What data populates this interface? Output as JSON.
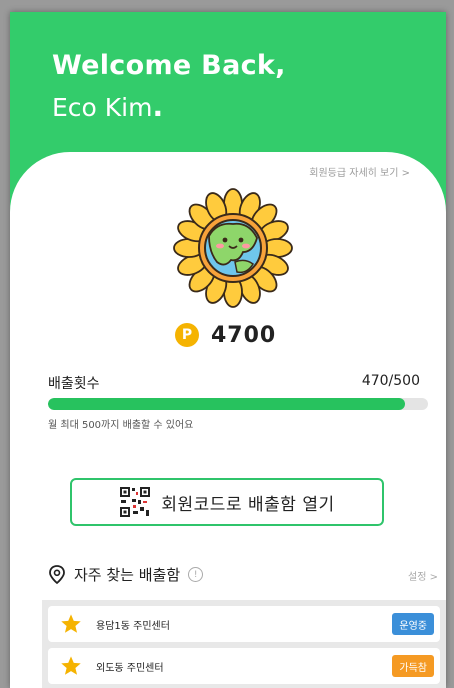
{
  "header": {
    "greeting": "Welcome Back,",
    "user_name": "Eco Kim",
    "user_suffix": "."
  },
  "grade_link": "회원등급 자세히 보기 >",
  "points": {
    "icon_letter": "P",
    "value": "4700"
  },
  "emission": {
    "label": "배출횟수",
    "value_text": "470/500",
    "progress": 0.94,
    "note": "월 최대 500까지 배출할 수 있어요"
  },
  "open_button": {
    "label": "회원코드로 배출함 열기"
  },
  "favorites": {
    "title": "자주 찾는 배출함",
    "info_icon": "!",
    "settings_label": "설정 >",
    "items": [
      {
        "name": "용담1동 주민센터",
        "status": "운영중",
        "status_color": "#3b8fd9"
      },
      {
        "name": "외도동 주민센터",
        "status": "가득참",
        "status_color": "#f59a23"
      }
    ]
  },
  "colors": {
    "brand": "#33cc6b",
    "progress": "#27c25e",
    "points": "#f5b301"
  }
}
